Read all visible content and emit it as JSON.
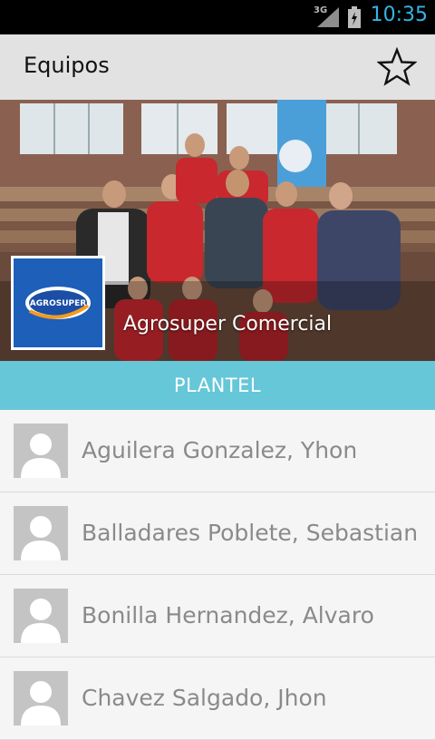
{
  "status": {
    "network": "3G",
    "time": "10:35"
  },
  "header": {
    "title": "Equipos",
    "favorite_icon": "star-outline-icon"
  },
  "team": {
    "name": "Agrosuper Comercial",
    "logo_text": "AGROSUPER"
  },
  "section": {
    "title": "PLANTEL"
  },
  "roster": [
    {
      "name": "Aguilera Gonzalez, Yhon"
    },
    {
      "name": "Balladares Poblete, Sebastian"
    },
    {
      "name": "Bonilla Hernandez, Alvaro"
    },
    {
      "name": "Chavez Salgado, Jhon"
    }
  ],
  "colors": {
    "accent": "#33b5e5",
    "section": "#65c7d8",
    "logo_blue": "#1d5fb9"
  }
}
